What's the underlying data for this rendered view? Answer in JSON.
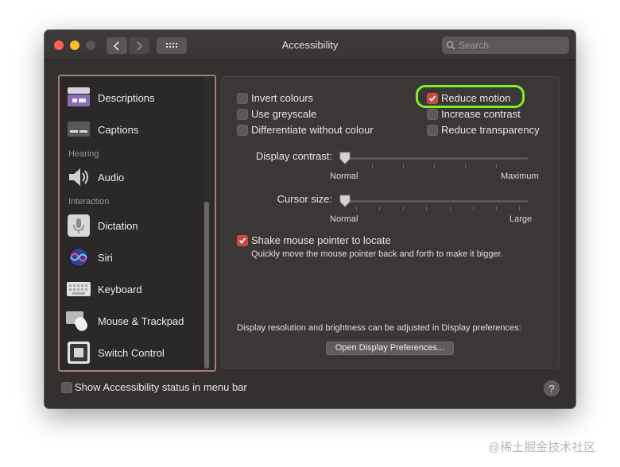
{
  "window": {
    "title": "Accessibility"
  },
  "search": {
    "placeholder": "Search"
  },
  "sidebar": {
    "items": [
      {
        "label": "Descriptions",
        "icon": "descriptions-icon"
      },
      {
        "label": "Captions",
        "icon": "captions-icon"
      },
      {
        "label": "Audio",
        "icon": "speaker-icon"
      },
      {
        "label": "Dictation",
        "icon": "microphone-icon"
      },
      {
        "label": "Siri",
        "icon": "siri-icon"
      },
      {
        "label": "Keyboard",
        "icon": "keyboard-icon"
      },
      {
        "label": "Mouse & Trackpad",
        "icon": "mouse-icon"
      },
      {
        "label": "Switch Control",
        "icon": "switch-control-icon"
      }
    ],
    "headings": {
      "hearing": "Hearing",
      "interaction": "Interaction"
    }
  },
  "options": {
    "invert_colours": {
      "label": "Invert colours",
      "checked": false
    },
    "use_greyscale": {
      "label": "Use greyscale",
      "checked": false
    },
    "differentiate": {
      "label": "Differentiate without colour",
      "checked": false
    },
    "reduce_motion": {
      "label": "Reduce motion",
      "checked": true
    },
    "increase_contrast": {
      "label": "Increase contrast",
      "checked": false
    },
    "reduce_transparency": {
      "label": "Reduce transparency",
      "checked": false
    }
  },
  "display_contrast": {
    "label": "Display contrast:",
    "min_label": "Normal",
    "max_label": "Maximum",
    "value": 0
  },
  "cursor_size": {
    "label": "Cursor size:",
    "min_label": "Normal",
    "max_label": "Large",
    "value": 0
  },
  "shake": {
    "label": "Shake mouse pointer to locate",
    "checked": true,
    "description": "Quickly move the mouse pointer back and forth to make it bigger."
  },
  "display_note": "Display resolution and brightness can be adjusted in Display preferences:",
  "open_display_button": "Open Display Preferences...",
  "footer": {
    "status_label": "Show Accessibility status in menu bar",
    "status_checked": false,
    "help": "?"
  },
  "colors": {
    "accent": "#c8473f",
    "highlight": "#7ef024",
    "window_bg": "#343030"
  },
  "watermark": "@稀土掘金技术社区"
}
